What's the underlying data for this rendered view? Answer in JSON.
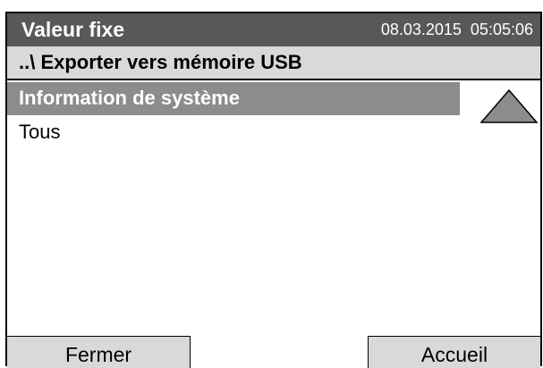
{
  "title_bar": {
    "title": "Valeur fixe",
    "date": "08.03.2015",
    "time": "05:05:06"
  },
  "path": {
    "label": "..\\ Exporter vers mémoire USB"
  },
  "list": {
    "items": [
      {
        "label": "Information de système",
        "selected": true
      },
      {
        "label": "Tous",
        "selected": false
      }
    ]
  },
  "scroll": {
    "up_icon": "triangle-up-icon"
  },
  "footer": {
    "close_label": "Fermer",
    "home_label": "Accueil"
  },
  "colors": {
    "title_bg": "#585858",
    "path_bg": "#d9d9d9",
    "selected_bg": "#8c8c8c",
    "button_bg": "#d9d9d9",
    "scroll_arrow": "#8c8c8c"
  }
}
